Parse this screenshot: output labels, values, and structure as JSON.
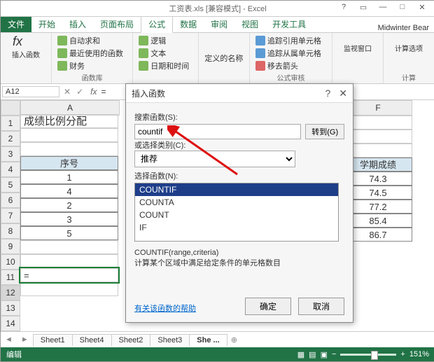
{
  "window": {
    "title": "工资表.xls [兼容模式] - Excel"
  },
  "user": "Midwinter Bear",
  "tabs": {
    "file": "文件",
    "items": [
      "开始",
      "插入",
      "页面布局",
      "公式",
      "数据",
      "审阅",
      "视图",
      "开发工具"
    ],
    "active": 3
  },
  "ribbon": {
    "fx": "fx",
    "insertFn": "插入函数",
    "g1": [
      "自动求和",
      "最近使用的函数",
      "财务"
    ],
    "g2": [
      "逻辑",
      "文本",
      "日期和时间"
    ],
    "g3": "定义的名称",
    "g4": [
      "追踪引用单元格",
      "追踪从属单元格",
      "移去箭头"
    ],
    "g5": "监视窗口",
    "g6": "计算选项",
    "grp1": "函数库",
    "grp2": "公式审核",
    "grp3": "计算"
  },
  "fbar": {
    "name": "A12",
    "formula": "="
  },
  "columns": {
    "A": "A",
    "F": "F"
  },
  "rows": [
    1,
    2,
    3,
    4,
    5,
    6,
    7,
    8,
    9,
    10,
    11,
    12,
    13,
    14
  ],
  "sheet": {
    "a1": "成绩比例分配",
    "a4": "序号",
    "f4": "学期成绩",
    "seq": [
      "1",
      "4",
      "2",
      "3",
      "5"
    ],
    "scores": [
      "74.3",
      "74.5",
      "77.2",
      "85.4",
      "86.7"
    ],
    "a12": "="
  },
  "dialog": {
    "title": "插入函数",
    "searchLabel": "搜索函数(S):",
    "search": "countif",
    "go": "转到(G)",
    "catLabel": "或选择类别(C):",
    "cat": "推荐",
    "selLabel": "选择函数(N):",
    "items": [
      "COUNTIF",
      "COUNTA",
      "COUNT",
      "IF"
    ],
    "sig": "COUNTIF(range,criteria)",
    "desc": "计算某个区域中满足给定条件的单元格数目",
    "help": "有关该函数的帮助",
    "ok": "确定",
    "cancel": "取消"
  },
  "sheetTabs": {
    "items": [
      "Sheet1",
      "Sheet4",
      "Sheet2",
      "Sheet3",
      "She ..."
    ],
    "plus": "⊕",
    "active": 4
  },
  "status": {
    "mode": "编辑",
    "zoom": "151%"
  }
}
